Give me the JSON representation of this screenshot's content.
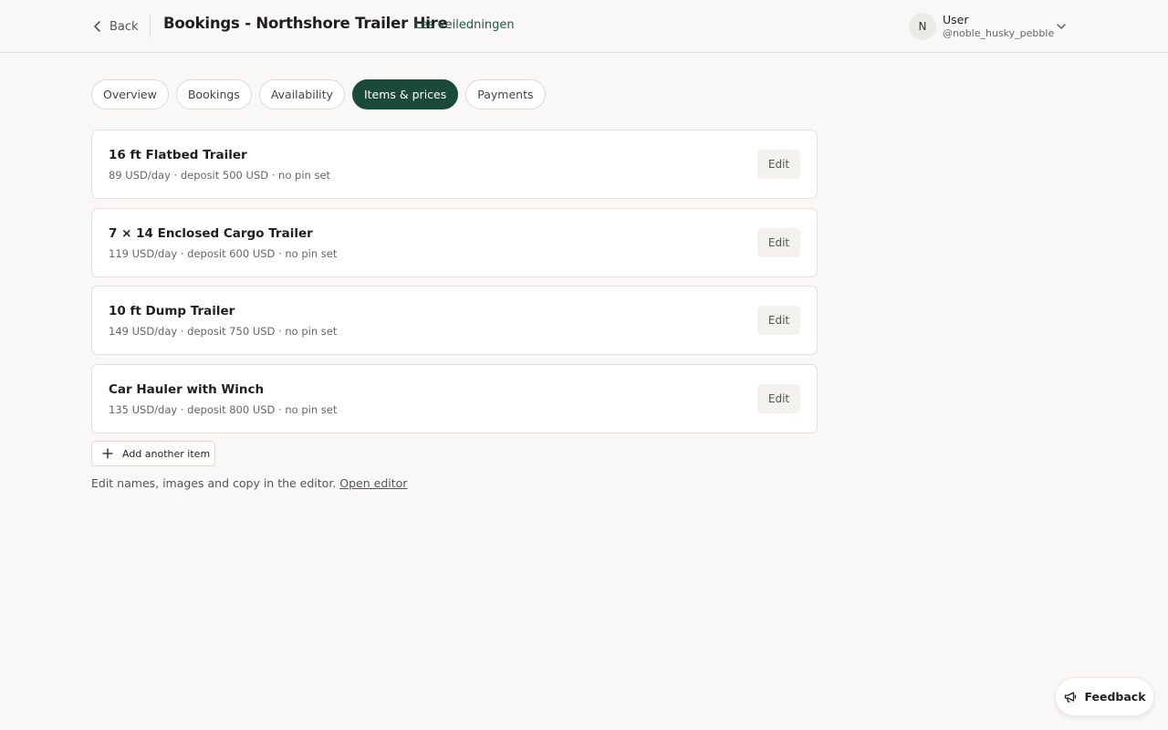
{
  "header": {
    "back_label": "Back",
    "title": "Bookings - Northshore Trailer Hire",
    "guide_link": "Les veiledningen",
    "user": {
      "initial": "N",
      "name": "User",
      "handle": "@noble_husky_pebble"
    }
  },
  "tabs": [
    {
      "label": "Overview",
      "active": false
    },
    {
      "label": "Bookings",
      "active": false
    },
    {
      "label": "Availability",
      "active": false
    },
    {
      "label": "Items & prices",
      "active": true
    },
    {
      "label": "Payments",
      "active": false
    }
  ],
  "items": [
    {
      "name": "16 ft Flatbed Trailer",
      "meta": "89 USD/day · deposit 500 USD · no pin set",
      "edit_label": "Edit"
    },
    {
      "name": "7 × 14 Enclosed Cargo Trailer",
      "meta": "119 USD/day · deposit 600 USD · no pin set",
      "edit_label": "Edit"
    },
    {
      "name": "10 ft Dump Trailer",
      "meta": "149 USD/day · deposit 750 USD · no pin set",
      "edit_label": "Edit"
    },
    {
      "name": "Car Hauler with Winch",
      "meta": "135 USD/day · deposit 800 USD · no pin set",
      "edit_label": "Edit"
    }
  ],
  "add_item_label": "Add another item",
  "hint": {
    "text": "Edit names, images and copy in the editor.",
    "link": "Open editor"
  },
  "feedback_label": "Feedback",
  "colors": {
    "accent": "#1b4a3a",
    "link": "#1d5a45",
    "background": "#f9f8f6"
  },
  "icons": {
    "back": "chevron-left-icon",
    "user_menu": "chevron-down-icon",
    "add": "plus-icon",
    "feedback": "megaphone-icon"
  }
}
